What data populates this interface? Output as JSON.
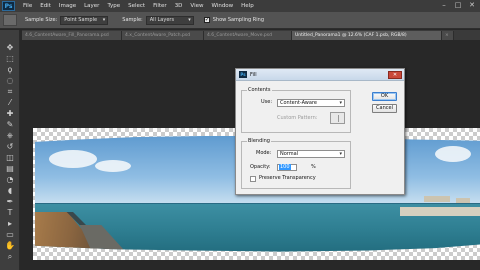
{
  "app": {
    "logo_text": "Ps",
    "menu": [
      "File",
      "Edit",
      "Image",
      "Layer",
      "Type",
      "Select",
      "Filter",
      "3D",
      "View",
      "Window",
      "Help"
    ],
    "window_controls": [
      "–",
      "□",
      "✕"
    ]
  },
  "options_bar": {
    "sample_size_label": "Sample Size:",
    "sample_size_value": "Point Sample",
    "sample_label": "Sample:",
    "sample_value": "All Layers",
    "show_ring_label": "Show Sampling Ring",
    "show_ring_checked": true
  },
  "doc_tabs": [
    {
      "label": "4.6_ContentAware_Fill_Panorama.psd",
      "active": false
    },
    {
      "label": "4.x_ContentAware_Patch.psd",
      "active": false
    },
    {
      "label": "4.6_ContentAware_Move.psd",
      "active": false
    },
    {
      "label": "Untitled_Panorama1 @ 12.6% (CAF 1.psb, RGB/8)",
      "active": true
    },
    {
      "label": "×",
      "active": false
    }
  ],
  "tools": [
    "move-tool",
    "marquee-tool",
    "lasso-tool",
    "quick-select-tool",
    "crop-tool",
    "eyedropper-tool",
    "healing-tool",
    "brush-tool",
    "stamp-tool",
    "history-brush-tool",
    "eraser-tool",
    "gradient-tool",
    "blur-tool",
    "dodge-tool",
    "pen-tool",
    "type-tool",
    "path-select-tool",
    "shape-tool",
    "hand-tool",
    "zoom-tool"
  ],
  "tool_glyphs": [
    "✥",
    "⬚",
    "ϙ",
    "◌",
    "⌗",
    "⁄",
    "✚",
    "✎",
    "⎈",
    "↺",
    "◫",
    "▤",
    "◔",
    "◖",
    "✒",
    "T",
    "▸",
    "▭",
    "✋",
    "⌕"
  ],
  "dialog": {
    "title": "Fill",
    "contents_group_label": "Contents",
    "use_label": "Use:",
    "use_value": "Content-Aware",
    "custom_pattern_label": "Custom Pattern:",
    "blending_group_label": "Blending",
    "mode_label": "Mode:",
    "mode_value": "Normal",
    "opacity_label": "Opacity:",
    "opacity_value": "100",
    "opacity_unit": "%",
    "preserve_label": "Preserve Transparency",
    "preserve_checked": false,
    "ok_label": "OK",
    "cancel_label": "Cancel"
  }
}
